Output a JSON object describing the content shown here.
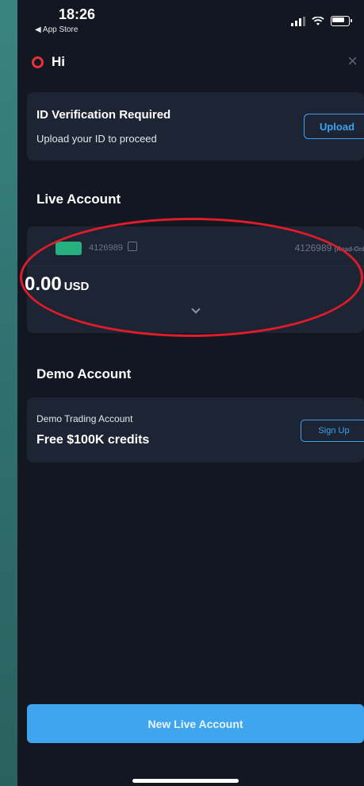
{
  "status_bar": {
    "time": "18:26",
    "back_label": "◀ App Store"
  },
  "header": {
    "greeting": "Hi",
    "close_icon": "×"
  },
  "id_verification": {
    "title": "ID Verification Required",
    "subtitle": "Upload your ID to proceed",
    "button_label": "Upload"
  },
  "live_account": {
    "section_title": "Live Account",
    "account_id": "4126989",
    "right_label": "4126989",
    "right_suffix": "(Read-Only)",
    "balance": "0.00",
    "currency": "USD"
  },
  "demo_account": {
    "section_title": "Demo Account",
    "subtitle": "Demo Trading Account",
    "title": "Free $100K credits",
    "button_label": "Sign Up"
  },
  "footer": {
    "button_label": "New Live Account"
  },
  "colors": {
    "accent": "#3ba3f2",
    "background": "#121722",
    "card": "#1d2433",
    "annotation": "#e01c2a",
    "tag": "#27b07f"
  }
}
